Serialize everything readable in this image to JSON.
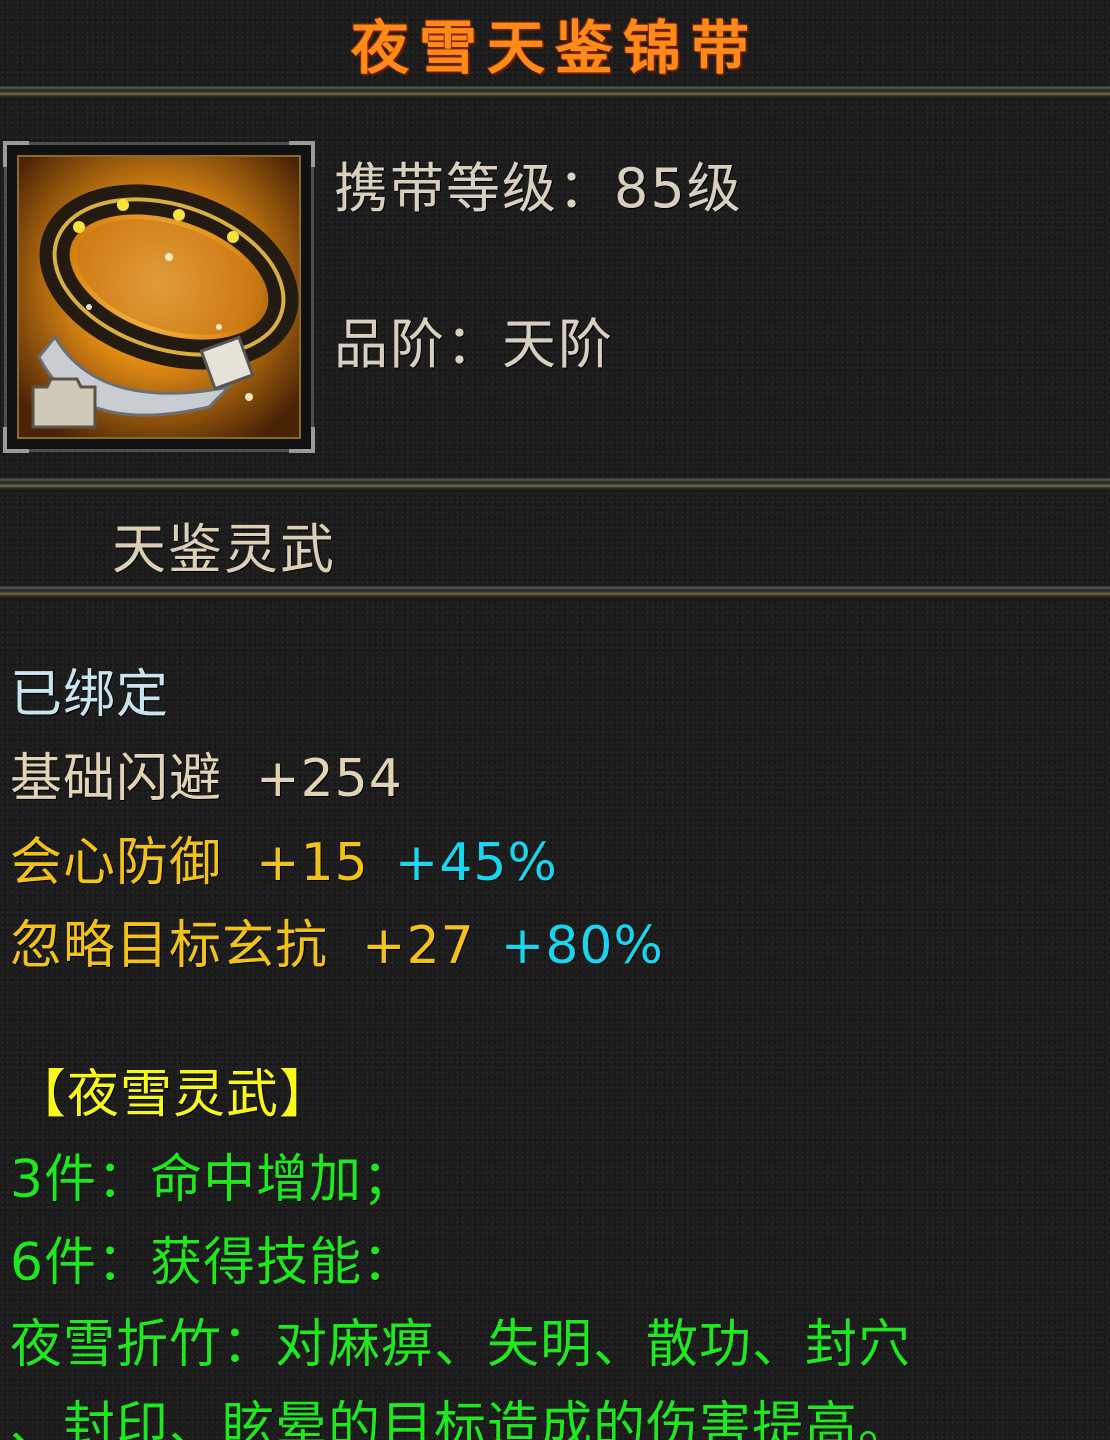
{
  "item": {
    "name": "夜雪天鉴锦带",
    "icon": "golden-belt-icon",
    "level_req": "携带等级：85级",
    "grade": "品阶：天阶",
    "set_name": "天鉴灵武",
    "bound": "已绑定"
  },
  "stats": [
    {
      "name": "基础闪避",
      "value": "+254",
      "bonus": ""
    },
    {
      "name": "会心防御",
      "value": "+15",
      "bonus": "+45%"
    },
    {
      "name": "忽略目标玄抗",
      "value": "+27",
      "bonus": "+80%"
    }
  ],
  "set_bonus": {
    "title": "【夜雪灵武】",
    "line3": "3件：命中增加；",
    "line6": "6件：获得技能：",
    "skill_line1": "夜雪折竹：对麻痹、失明、散功、封穴",
    "skill_line2": "、封印、眩晕的目标造成的伤害提高。"
  },
  "colors": {
    "title": "#ff8a1a",
    "beige": "#e2d3b4",
    "gold": "#f3c21a",
    "cyan": "#18d6ee",
    "green": "#1ee81e",
    "yellow": "#f8f81a"
  }
}
